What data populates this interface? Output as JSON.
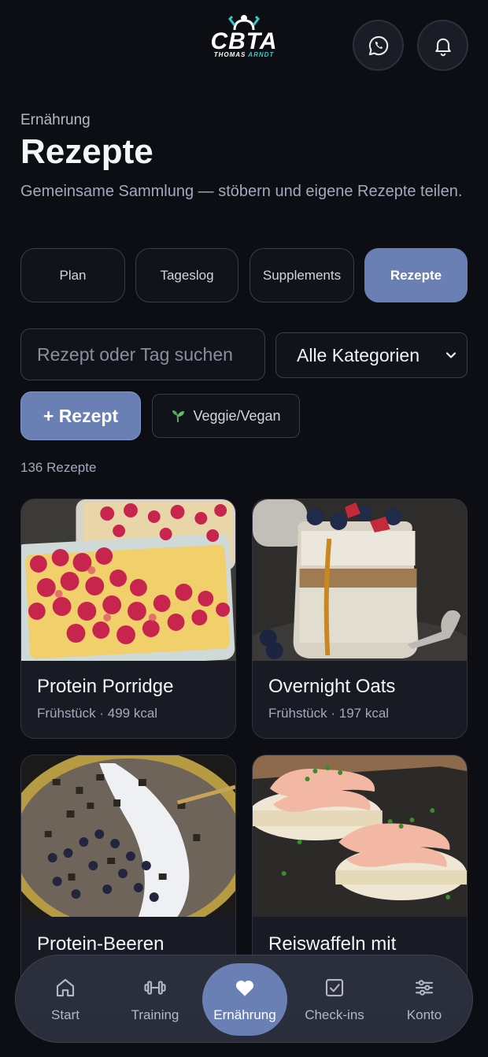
{
  "header": {
    "logo": {
      "brand": "CBTA",
      "sub_first": "THOMAS",
      "sub_second": "ARNDT"
    },
    "whatsapp_icon": "whatsapp-icon",
    "bell_icon": "bell-icon"
  },
  "page": {
    "eyebrow": "Ernährung",
    "title": "Rezepte",
    "subtitle": "Gemeinsame Sammlung — stöbern und eigene Rezepte teilen."
  },
  "tabs": [
    {
      "label": "Plan",
      "active": false
    },
    {
      "label": "Tageslog",
      "active": false
    },
    {
      "label": "Supplements",
      "active": false
    },
    {
      "label": "Rezepte",
      "active": true
    }
  ],
  "filters": {
    "search_placeholder": "Rezept oder Tag suchen",
    "search_value": "",
    "category_selected": "Alle Kategorien",
    "add_label": "+ Rezept",
    "veg_label": "Veggie/Vegan"
  },
  "count_label": "136 Rezepte",
  "recipes": [
    {
      "name": "Protein Porridge",
      "meta": "Frühstück · 499 kcal"
    },
    {
      "name": "Overnight Oats",
      "meta": "Frühstück · 197 kcal"
    },
    {
      "name": "Protein-Beeren",
      "meta": ""
    },
    {
      "name": "Reiswaffeln mit",
      "meta": ""
    }
  ],
  "nav": [
    {
      "label": "Start",
      "icon": "home-icon"
    },
    {
      "label": "Training",
      "icon": "dumbbell-icon"
    },
    {
      "label": "Ernährung",
      "icon": "heart-icon",
      "active": true
    },
    {
      "label": "Check-ins",
      "icon": "checkbox-icon"
    },
    {
      "label": "Konto",
      "icon": "sliders-icon"
    }
  ],
  "colors": {
    "accent": "#6a80b5",
    "background": "#0d0e14",
    "brand_teal": "#39c6c9"
  }
}
